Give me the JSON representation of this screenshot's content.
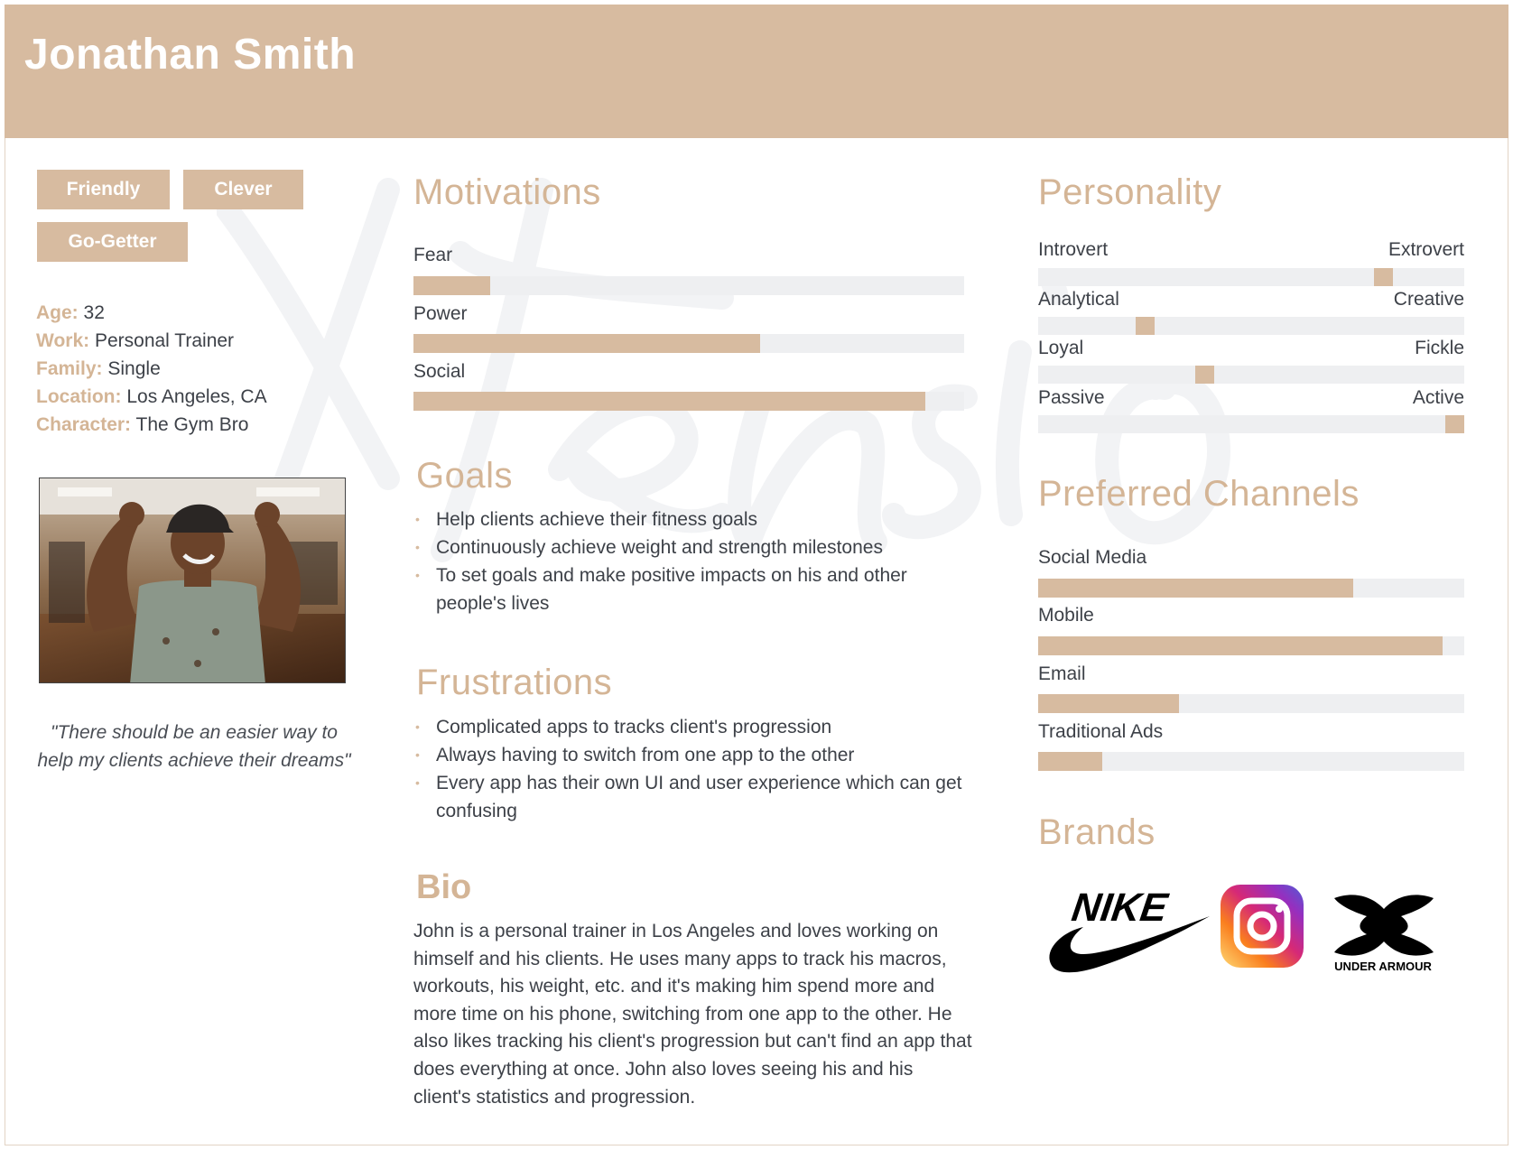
{
  "header": {
    "name": "Jonathan Smith"
  },
  "tags": [
    "Friendly",
    "Clever",
    "Go-Getter"
  ],
  "attributes": [
    {
      "key": "Age:",
      "value": "32"
    },
    {
      "key": "Work:",
      "value": "Personal Trainer"
    },
    {
      "key": "Family:",
      "value": "Single"
    },
    {
      "key": "Location:",
      "value": "Los Angeles, CA"
    },
    {
      "key": "Character:",
      "value": "The Gym Bro"
    }
  ],
  "quote": "\"There should be an easier way to help my clients achieve their dreams\"",
  "motivations": {
    "title": "Motivations",
    "items": [
      {
        "label": "Fear",
        "value": 0.14
      },
      {
        "label": "Power",
        "value": 0.63
      },
      {
        "label": "Social",
        "value": 0.93
      }
    ]
  },
  "goals": {
    "title": "Goals",
    "items": [
      "Help clients achieve their fitness goals",
      "Continuously achieve weight and strength milestones",
      "To set goals and make positive impacts on his and other people's lives"
    ]
  },
  "frustrations": {
    "title": "Frustrations",
    "items": [
      "Complicated apps to tracks client's progression",
      "Always having to switch from one app to the other",
      "Every app has their own UI and user experience which can get confusing"
    ]
  },
  "bio": {
    "title": "Bio",
    "text": "John is a personal trainer in Los Angeles and loves working on himself and his clients. He uses many apps to track his macros, workouts, his weight, etc. and it's making him spend more and more time on his phone, switching from one app to the other. He also likes tracking his client's progression but can't find an app that does everything at once. John also loves seeing his and his client's statistics and progression."
  },
  "personality": {
    "title": "Personality",
    "traits": [
      {
        "left": "Introvert",
        "right": "Extrovert",
        "value": 0.81
      },
      {
        "left": "Analytical",
        "right": "Creative",
        "value": 0.25
      },
      {
        "left": "Loyal",
        "right": "Fickle",
        "value": 0.39
      },
      {
        "left": "Passive",
        "right": "Active",
        "value": 0.98
      }
    ]
  },
  "channels": {
    "title": "Preferred Channels",
    "items": [
      {
        "label": "Social Media",
        "value": 0.74
      },
      {
        "label": "Mobile",
        "value": 0.95
      },
      {
        "label": "Email",
        "value": 0.33
      },
      {
        "label": "Traditional Ads",
        "value": 0.15
      }
    ]
  },
  "brands": {
    "title": "Brands",
    "logos": [
      {
        "name": "nike-logo",
        "text": "NIKE"
      },
      {
        "name": "instagram-logo"
      },
      {
        "name": "under-armour-logo",
        "text": "UNDER ARMOUR"
      }
    ]
  },
  "watermark": {
    "text": "Xtensio"
  },
  "colors": {
    "accent": "#d7bba0",
    "accent_text": "#d4b596",
    "track": "#eeeff1",
    "text": "#3d4148",
    "header": "#d7bba0"
  }
}
